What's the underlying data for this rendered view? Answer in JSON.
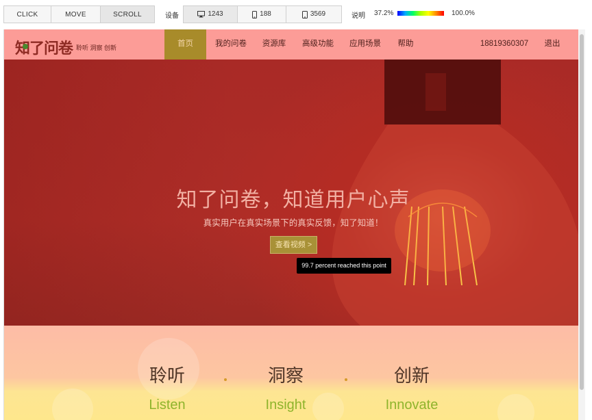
{
  "toolbar": {
    "modes": [
      {
        "label": "CLICK",
        "active": false
      },
      {
        "label": "MOVE",
        "active": false
      },
      {
        "label": "SCROLL",
        "active": true
      }
    ],
    "device_label": "设备",
    "devices": [
      {
        "icon": "desktop-icon",
        "count": "1243"
      },
      {
        "icon": "mobile-icon",
        "count": "188"
      },
      {
        "icon": "tablet-icon",
        "count": "3569"
      }
    ],
    "legend_label": "说明",
    "legend_min": "37.2%",
    "legend_max": "100.0%",
    "legend_colors": [
      "#0000ff",
      "#00aaff",
      "#00ff66",
      "#ffff00",
      "#ff0000"
    ]
  },
  "site": {
    "logo": "知了问卷",
    "slogan": "聆听 洞察 创新",
    "nav": [
      "首页",
      "我的问卷",
      "资源库",
      "高级功能",
      "应用场景",
      "帮助"
    ],
    "active_nav": "首页",
    "user_phone": "18819360307",
    "logout": "退出"
  },
  "hero": {
    "title": "知了问卷，知道用户心声",
    "subtitle": "真实用户在真实场景下的真实反馈，知了知道！",
    "button": "查看视频 >"
  },
  "tooltip": "99.7 percent reached this point",
  "features": [
    {
      "cn": "聆听",
      "en": "Listen"
    },
    {
      "cn": "洞察",
      "en": "Insight"
    },
    {
      "cn": "创新",
      "en": "Innovate"
    }
  ],
  "colors": {
    "nav_bg": "#fc9c97",
    "active_nav_bg": "#a88b2a",
    "hero_red": "#ae2d27",
    "feature_green": "#8fb42c"
  }
}
